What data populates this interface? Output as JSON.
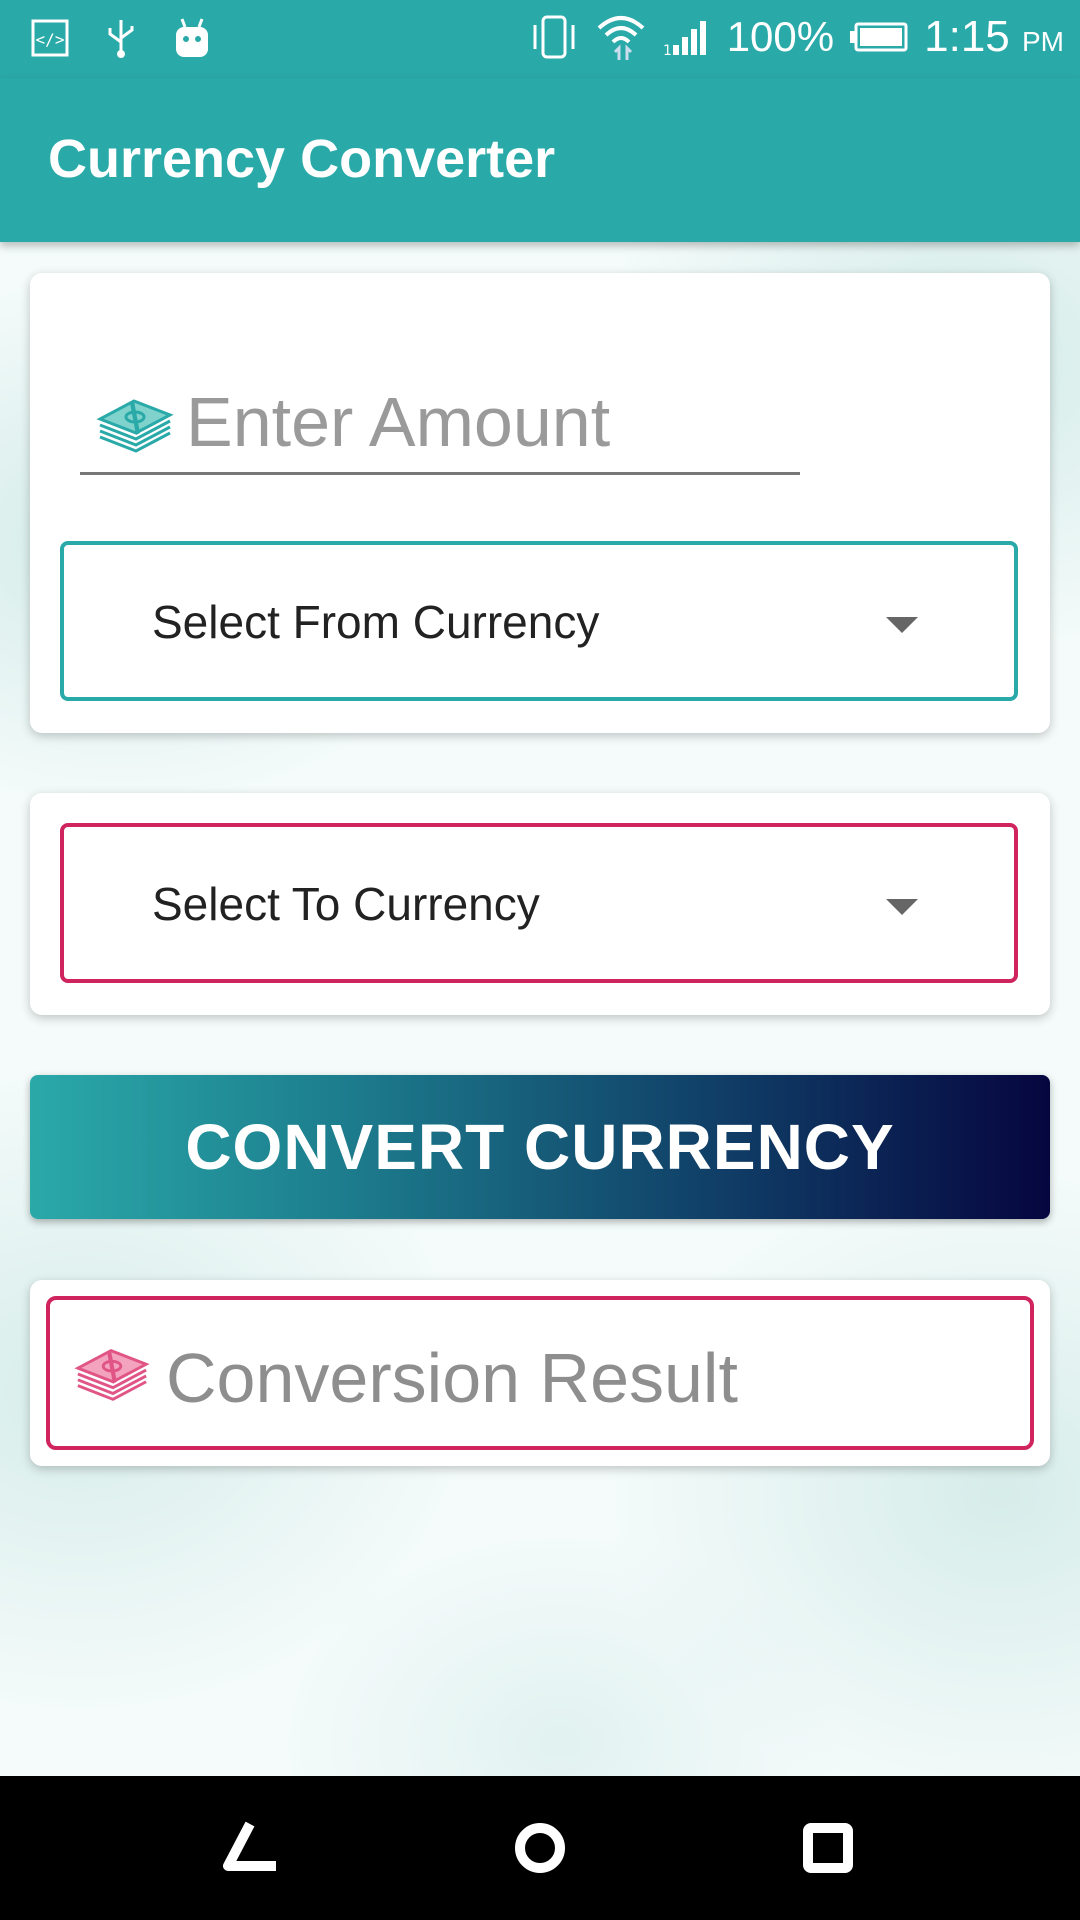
{
  "status_bar": {
    "battery": "100%",
    "time": "1:15",
    "ampm": "PM",
    "icons": [
      "code-icon",
      "usb-icon",
      "android-icon",
      "vibrate-icon",
      "wifi-icon",
      "signal-icon",
      "battery-icon"
    ]
  },
  "app_bar": {
    "title": "Currency Converter",
    "color": "#2aa9a9"
  },
  "amount": {
    "placeholder": "Enter Amount",
    "value": "",
    "icon": "money-stack-icon",
    "icon_color": "#2aa9a9"
  },
  "from_currency": {
    "label": "Select From Currency",
    "border_color": "#2aa9a9"
  },
  "to_currency": {
    "label": "Select To Currency",
    "border_color": "#d0245f"
  },
  "convert_button": {
    "label": "CONVERT CURRENCY"
  },
  "result": {
    "placeholder": "Conversion Result",
    "icon": "money-stack-icon",
    "icon_color": "#e05585",
    "border_color": "#d0245f"
  },
  "nav_bar": {
    "buttons": [
      "back-icon",
      "home-icon",
      "recent-apps-icon"
    ]
  }
}
